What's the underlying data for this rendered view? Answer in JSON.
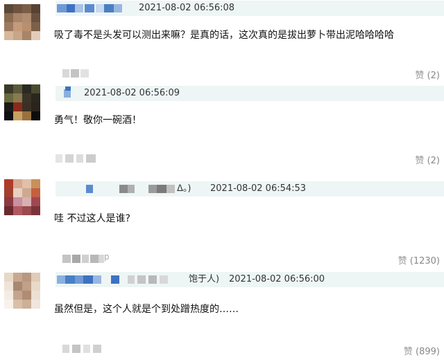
{
  "comments": [
    {
      "handle_tail": "",
      "time": "2021-08-02 06:56:08",
      "text": "吸了毒不是头发可以测出来嘛？是真的话，这次真的是拔出萝卜带出泥哈哈哈哈",
      "reply_tail": "",
      "like_label": "赞",
      "like_count": "(2)"
    },
    {
      "handle_tail": "",
      "time": "2021-08-02 06:56:09",
      "text": "勇气！敬你一碗酒！",
      "reply_tail": "",
      "like_label": "赞",
      "like_count": "(2)"
    },
    {
      "handle_tail": "ᐃ。)",
      "time": "2021-08-02 06:54:53",
      "text": "哇 不过这人是谁?",
      "reply_tail": "p",
      "like_label": "赞",
      "like_count": "(1230)"
    },
    {
      "handle_tail": "饱于人)",
      "time": "2021-08-02 06:56:00",
      "text": "虽然但是，这个人就是个到处蹭热度的……",
      "reply_tail": "",
      "like_label": "赞",
      "like_count": "(899)"
    }
  ],
  "colors": {
    "meta_bar_bg": "#eef5f5",
    "time_text": "#333333",
    "like_text": "#888888",
    "blur_blue": "#4a7fc4"
  }
}
